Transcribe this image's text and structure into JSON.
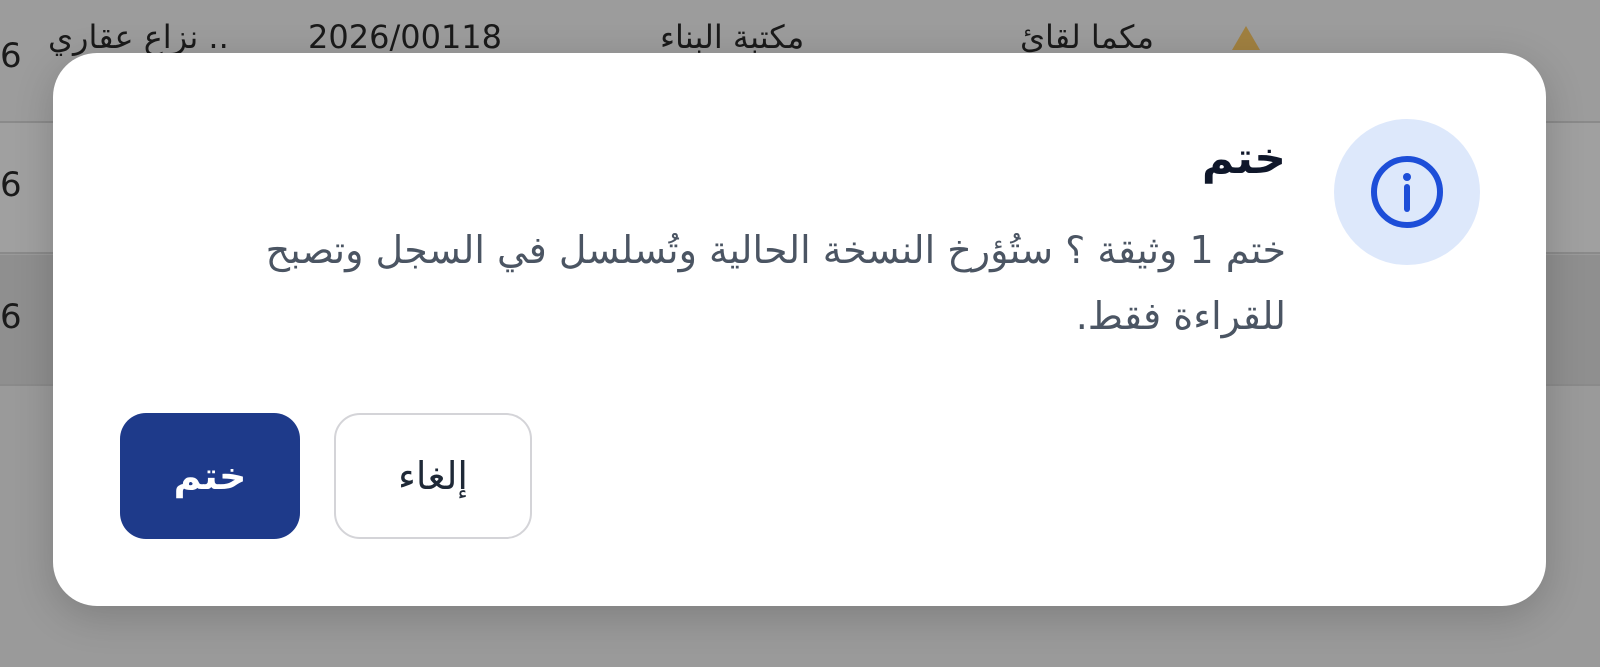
{
  "background": {
    "rows": [
      {
        "number": "6",
        "text_document": "2026/00118",
        "text_party": "نزاع عقاري ..",
        "text_name": "مكتبة البناء",
        "text_extra": "مكما لقائ"
      },
      {
        "number": "6"
      },
      {
        "number": "6"
      }
    ]
  },
  "dialog": {
    "icon": "info-icon",
    "title": "ختم",
    "message": "ختم 1 وثيقة ؟ ستُؤرخ النسخة الحالية وتُسلسل في السجل وتصبح للقراءة فقط.",
    "cancel_label": "إلغاء",
    "confirm_label": "ختم"
  },
  "colors": {
    "overlay": "#9a9a9a",
    "dialog_bg": "#ffffff",
    "icon_circle_bg": "#dde8fb",
    "icon_stroke": "#1d4ed8",
    "confirm_bg": "#1e3a8a",
    "title_text": "#0f172a",
    "message_text": "#4b5563"
  }
}
